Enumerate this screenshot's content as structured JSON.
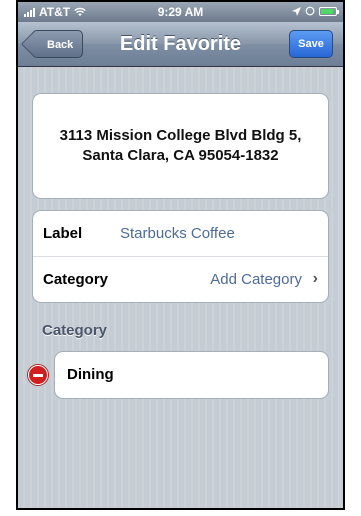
{
  "status_bar": {
    "carrier": "AT&T",
    "time": "9:29 AM"
  },
  "nav_bar": {
    "back_label": "Back",
    "title": "Edit Favorite",
    "save_label": "Save"
  },
  "address": {
    "line1": "3113 Mission College Blvd Bldg 5,",
    "line2": "Santa Clara, CA 95054-1832"
  },
  "details": {
    "label_key": "Label",
    "label_value": "Starbucks Coffee",
    "category_key": "Category",
    "category_action": "Add Category",
    "chevron": "›"
  },
  "category_section": {
    "header": "Category",
    "items": [
      "Dining"
    ]
  },
  "colors": {
    "nav_bar": "#7e8ea3",
    "save_button": "#2767d5",
    "link_text": "#4d6b98",
    "delete": "#d11f1f"
  }
}
